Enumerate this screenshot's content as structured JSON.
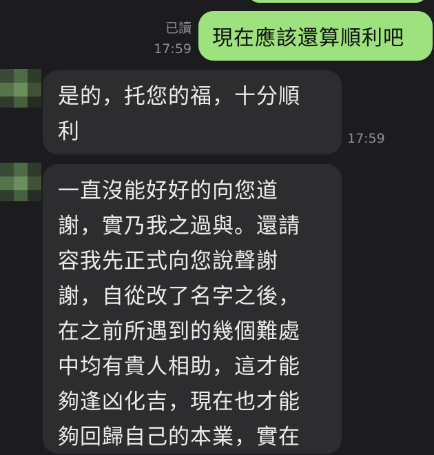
{
  "chat": {
    "sent_message": "現在應該還算順利吧",
    "sent_read_status": "已讀",
    "sent_time": "17:59",
    "reply_1_lines": [
      "是的，托您的福，十分順",
      "利"
    ],
    "reply_1_time": "17:59",
    "reply_2_lines": [
      "一直沒能好好的向您道",
      "謝，實乃我之過與。還請",
      "容我先正式向您說聲謝",
      "謝，自從改了名字之後，",
      "在之前所遇到的幾個難處",
      "中均有貴人相助，這才能",
      "夠逢凶化吉，現在也才能",
      "夠回歸自己的本業，實在"
    ]
  },
  "colors": {
    "background": "#1c1c1e",
    "sent_bubble": "#9de27e",
    "received_bubble": "#2d2d30",
    "meta_text": "#8e8e93"
  },
  "avatar": {
    "appearance": "pixelated-blurred"
  }
}
